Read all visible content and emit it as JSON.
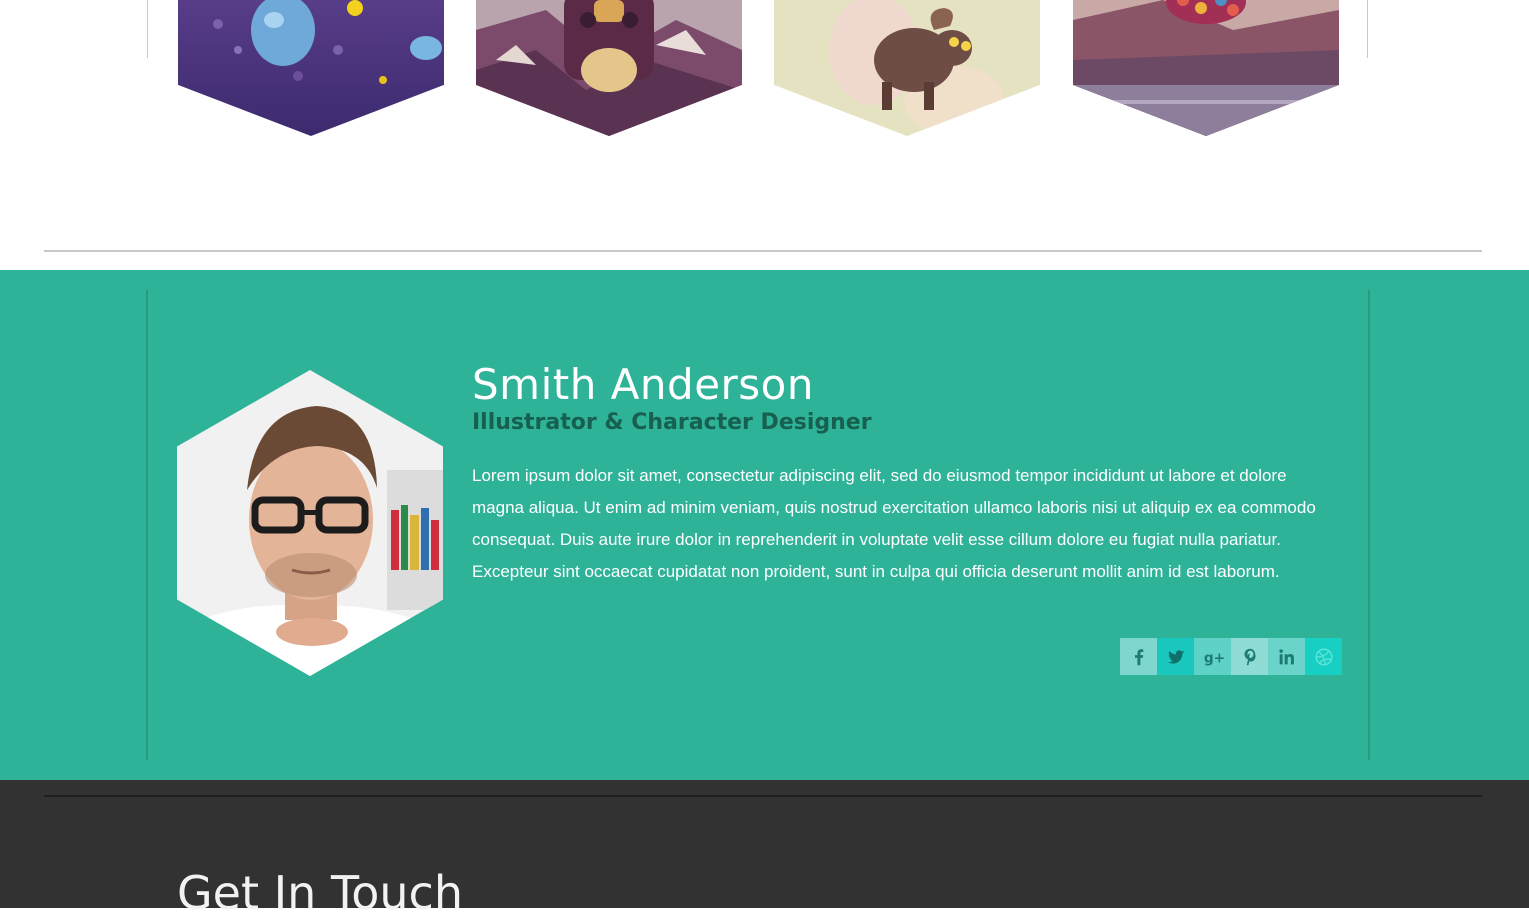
{
  "portfolio": {
    "items": [
      {
        "name": "portfolio-item-1"
      },
      {
        "name": "portfolio-item-2"
      },
      {
        "name": "portfolio-item-3"
      },
      {
        "name": "portfolio-item-4"
      }
    ]
  },
  "profile": {
    "name": "Smith Anderson",
    "role": "Illustrator & Character Designer",
    "bio": "Lorem ipsum dolor sit amet, consectetur adipiscing elit, sed do eiusmod tempor incididunt ut labore et dolore magna aliqua. Ut enim ad minim veniam, quis nostrud exercitation ullamco laboris nisi ut aliquip ex ea commodo consequat. Duis aute irure dolor in reprehenderit in voluptate velit esse cillum dolore eu fugiat nulla pariatur. Excepteur sint occaecat cupidatat non proident, sunt in culpa qui officia deserunt mollit anim id est laborum.",
    "social": [
      {
        "icon": "facebook-icon",
        "color": "#7fd6cf"
      },
      {
        "icon": "twitter-icon",
        "color": "#19c7be"
      },
      {
        "icon": "google-plus-icon",
        "color": "#5fd2c7"
      },
      {
        "icon": "pinterest-icon",
        "color": "#8fdcd5"
      },
      {
        "icon": "linkedin-icon",
        "color": "#6ad4cb"
      },
      {
        "icon": "dribbble-icon",
        "color": "#18cfc3"
      }
    ]
  },
  "colors": {
    "band": "#2eb398",
    "role_text": "#17604f",
    "footer": "#323232"
  },
  "footer": {
    "heading": "Get In Touch"
  }
}
